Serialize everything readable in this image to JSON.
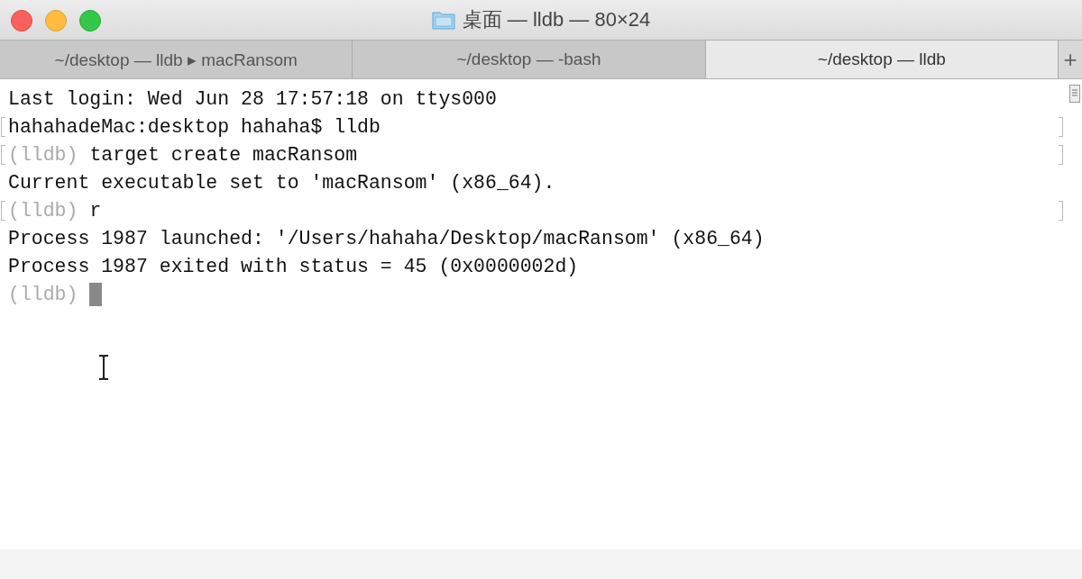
{
  "window": {
    "title": "桌面 — lldb — 80×24"
  },
  "tabs": [
    {
      "label": "~/desktop — lldb ▸ macRansom",
      "selected": false
    },
    {
      "label": "~/desktop — -bash",
      "selected": false
    },
    {
      "label": "~/desktop — lldb",
      "selected": true
    }
  ],
  "new_tab": {
    "label": "+"
  },
  "terminal": {
    "lines": [
      {
        "text": "Last login: Wed Jun 28 17:57:18 on ttys000",
        "marked": false
      },
      {
        "text": "hahahadeMac:desktop hahaha$ lldb",
        "marked": true
      },
      {
        "prompt": "(lldb)",
        "text": "target create macRansom",
        "marked": true
      },
      {
        "text": "Current executable set to 'macRansom' (x86_64).",
        "marked": false
      },
      {
        "prompt": "(lldb)",
        "text": "r",
        "marked": true
      },
      {
        "text": "Process 1987 launched: '/Users/hahaha/Desktop/macRansom' (x86_64)",
        "marked": false
      },
      {
        "text": "Process 1987 exited with status = 45 (0x0000002d)",
        "marked": false
      },
      {
        "prompt": "(lldb)",
        "marked": false,
        "cursor": true
      }
    ]
  }
}
